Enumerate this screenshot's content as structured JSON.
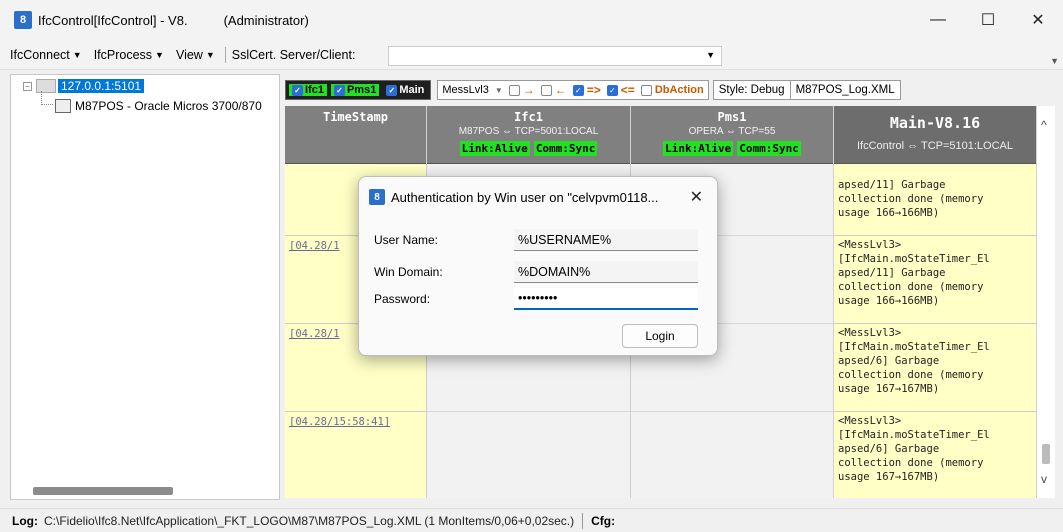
{
  "window": {
    "title": "IfcControl[IfcControl] - V8.",
    "admin": "(Administrator)",
    "icon_glyph": "8"
  },
  "menubar": {
    "items": [
      "IfcConnect",
      "IfcProcess",
      "View"
    ],
    "ssl_label": "SslCert. Server/Client:",
    "ssl_value": ""
  },
  "tree": {
    "node1_label": "127.0.0.1:5101",
    "node2_label": "M87POS - Oracle Micros 3700/870"
  },
  "toolbar": {
    "chips": [
      {
        "label": "Ifc1",
        "style": "green"
      },
      {
        "label": "Pms1",
        "style": "green"
      },
      {
        "label": "Main",
        "style": "white"
      }
    ],
    "mess_level": "MessLvl3",
    "arrow_right": "→",
    "arrow_left": "←",
    "arrow_double_right": "=>",
    "arrow_double_left": "<=",
    "db_action": "DbAction",
    "style_label": "Style: Debug",
    "log_file": "M87POS_Log.XML"
  },
  "grid": {
    "timestamp_header": "TimeStamp",
    "ifc1": {
      "title": "Ifc1",
      "subtitle": "M87POS ⇔ TCP=5001:LOCAL",
      "badges": [
        "Link:Alive",
        "Comm:Sync"
      ]
    },
    "pms1": {
      "title": "Pms1",
      "subtitle": "OPERA ⇔ TCP=55",
      "badges": [
        "Link:Alive",
        "Comm:Sync"
      ]
    },
    "main": {
      "title": "Main-V8.16",
      "subtitle": "IfcControl ⇔ TCP=5101:LOCAL"
    },
    "rows": [
      {
        "timestamp": "",
        "main_text": "apsed/11] Garbage\ncollection done (memory\nusage 166→166MB)"
      },
      {
        "timestamp": "[04.28/1",
        "main_text": "<MessLvl3>\n[IfcMain.moStateTimer_El\napsed/11] Garbage\ncollection done (memory\nusage 166→166MB)"
      },
      {
        "timestamp": "[04.28/1",
        "main_text": "<MessLvl3>\n[IfcMain.moStateTimer_El\napsed/6] Garbage\ncollection done (memory\nusage 167→167MB)"
      },
      {
        "timestamp": "[04.28/15:58:41]",
        "main_text": "<MessLvl3>\n[IfcMain.moStateTimer_El\napsed/6] Garbage\ncollection done (memory\nusage 167→167MB)"
      }
    ]
  },
  "dialog": {
    "title": "Authentication by Win user on \"celvpvm0118...",
    "username_label": "User Name:",
    "username_value": "%USERNAME%",
    "domain_label": "Win Domain:",
    "domain_value": "%DOMAIN%",
    "password_label": "Password:",
    "password_value": "•••••••••",
    "login_label": "Login"
  },
  "statusbar": {
    "log_label": "Log:",
    "log_path": "C:\\Fidelio\\Ifc8.Net\\IfcApplication\\_FKT_LOGO\\M87\\M87POS_Log.XML (1 MonItems/0,06+0,02sec.)",
    "cfg_label": "Cfg:"
  }
}
